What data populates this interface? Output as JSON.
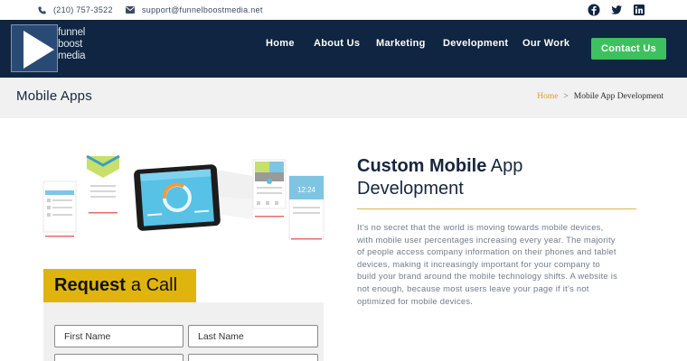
{
  "topbar": {
    "phone": "(210) 757-3522",
    "email": "support@funnelboostmedia.net",
    "social": [
      "facebook-icon",
      "twitter-icon",
      "linkedin-icon"
    ]
  },
  "nav": {
    "logo_lines": [
      "funnel",
      "boost",
      "media"
    ],
    "links": [
      "Home",
      "About Us",
      "Marketing",
      "Development",
      "Our Work"
    ],
    "cta": "Contact Us"
  },
  "page_header": {
    "title": "Mobile Apps",
    "breadcrumb": {
      "home": "Home",
      "separator": ">",
      "current": "Mobile App Development"
    }
  },
  "illustration": {
    "clock_text": "12:24"
  },
  "request_call": {
    "title_bold": "Request",
    "title_rest": "a Call",
    "placeholders": {
      "first_name": "First Name",
      "last_name": "Last Name"
    }
  },
  "content": {
    "heading_bold": "Custom Mobile",
    "heading_rest_1": "App",
    "heading_rest_2": "Development",
    "paragraph": "It’s no secret that the world is moving towards mobile devices, with mobile user percentages increasing every year. The majority of people access company information on their phones and tablet devices, making it increasingly important for your company to build your brand around the mobile technology shifts. A website is not enough, because most users leave your page if it’s not optimized for mobile devices."
  },
  "colors": {
    "nav_bg": "#0f2541",
    "cta_green": "#3fc060",
    "request_yellow": "#e0b40e",
    "breadcrumb_home": "#e59a1a",
    "heading_navy": "#16263d"
  }
}
